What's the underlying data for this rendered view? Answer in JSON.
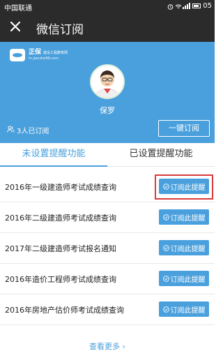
{
  "status_bar": {
    "carrier": "中国联通",
    "time": "05"
  },
  "nav": {
    "title": "微信订阅"
  },
  "brand": {
    "name": "正保",
    "tagline": "建设工程教育网",
    "domain": "m.jianshe99.com"
  },
  "profile": {
    "nickname": "保罗",
    "subscribers": "3人已订阅",
    "subscribe_all_label": "一键订阅"
  },
  "tabs": [
    {
      "label": "未设置提醒功能"
    },
    {
      "label": "已设置提醒功能"
    }
  ],
  "items": [
    {
      "title": "2016年一级建造师考试成绩查询",
      "button": "订阅此提醒"
    },
    {
      "title": "2016年二级建造师考试成绩查询",
      "button": "订阅此提醒"
    },
    {
      "title": "2017年二级建造师考试报名通知",
      "button": "订阅此提醒"
    },
    {
      "title": "2016年造价工程师考试成绩查询",
      "button": "订阅此提醒"
    },
    {
      "title": "2016年房地产估价师考试成绩查询",
      "button": "订阅此提醒"
    }
  ],
  "more_label": "查看更多",
  "colors": {
    "accent": "#4aa0dd",
    "bar": "#2b2b2b",
    "highlight": "#d93a3a"
  }
}
